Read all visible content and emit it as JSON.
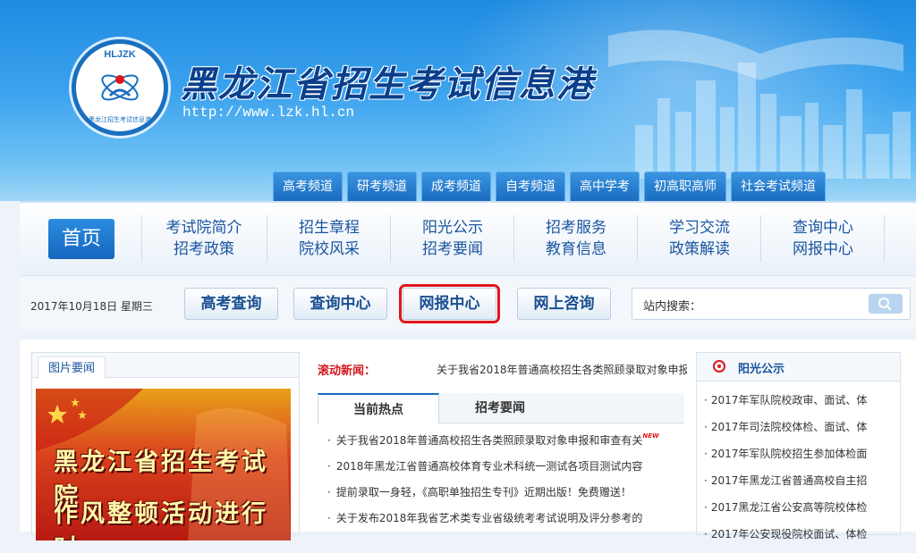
{
  "header": {
    "logo_top": "HLJZK",
    "logo_bottom": "黑龙江招生考试信息港",
    "site_title": "黑龙江省招生考试信息港",
    "site_url": "http://www.lzk.hl.cn",
    "channels": [
      "高考频道",
      "研考频道",
      "成考频道",
      "自考频道",
      "高中学考",
      "初高职高师",
      "社会考试频道"
    ]
  },
  "nav": {
    "home": "首页",
    "columns": [
      [
        "考试院简介",
        "招考政策"
      ],
      [
        "招生章程",
        "院校风采"
      ],
      [
        "阳光公示",
        "招考要闻"
      ],
      [
        "招考服务",
        "教育信息"
      ],
      [
        "学习交流",
        "政策解读"
      ],
      [
        "查询中心",
        "网报中心"
      ]
    ]
  },
  "quickbar": {
    "date": "2017年10月18日 星期三",
    "buttons": [
      "高考查询",
      "查询中心",
      "网报中心",
      "网上咨询"
    ],
    "search_label": "站内搜索：",
    "search_placeholder": ""
  },
  "left_panel": {
    "tab": "图片要闻",
    "poster_line1": "黑龙江省招生考试院",
    "poster_line2": "作风整顿活动进行时"
  },
  "mid_panel": {
    "scroll_label": "滚动新闻：",
    "scroll_text": "关于我省2018年普通高校招生各类照顾录取对象申报",
    "tabs": [
      "当前热点",
      "招考要闻"
    ],
    "news": [
      "关于我省2018年普通高校招生各类照顾录取对象申报和审查有关",
      "2018年黑龙江省普通高校体育专业术科统一测试各项目测试内容",
      "提前录取一身轻，《高职单独招生专刊》近期出版！免费赠送！",
      "关于发布2018年我省艺术类专业省级统考考试说明及评分参考的"
    ],
    "new_badge": "NEW"
  },
  "right_panel": {
    "title": "阳光公示",
    "items": [
      "2017年军队院校政审、面试、体",
      "2017年司法院校体检、面试、体",
      "2017年军队院校招生参加体检面",
      "2017年黑龙江省普通高校自主招",
      "2017黑龙江省公安高等院校体检",
      "2017年公安现役院校面试、体检"
    ]
  },
  "colors": {
    "accent": "#1a6cc0",
    "highlight": "#e0161b"
  }
}
